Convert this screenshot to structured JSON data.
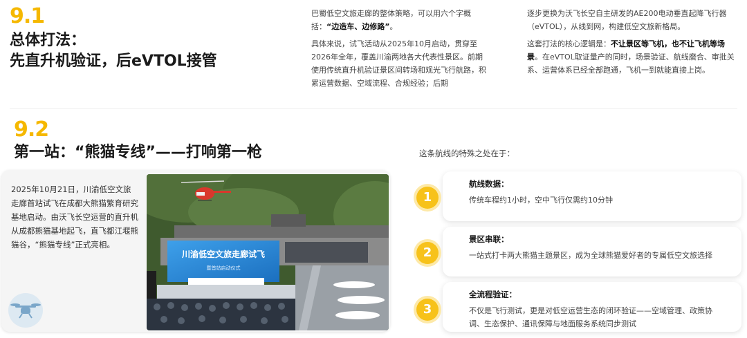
{
  "section1": {
    "number": "9.1",
    "title_line1": "总体打法：",
    "title_line2": "先直升机验证，后eVTOL接管"
  },
  "middle_col": {
    "p1_text": "巴蜀低空文旅走廊的整体策略，可以用六个字概括：",
    "p1_bold": "“边造车、边修路”",
    "p1_end": "。",
    "p2": "具体来说，试飞活动从2025年10月启动，贯穿至2026年全年，覆盖川渝两地各大代表性景区。前期使用传统直升机验证景区间转场和观光飞行航路，积累运营数据、空域流程、合规经验；后期"
  },
  "right_col": {
    "p1": "逐步更换为沃飞长空自主研发的AE200电动垂直起降飞行器（eVTOL），从线到网，构建低空文旅新格局。",
    "p2_start": "这套打法的核心逻辑是：",
    "p2_bold": "不让景区等飞机，也不让飞机等场景",
    "p2_end": "。在eVTOL取证量产的同时，场景验证、航线磨合、审批关系、运营体系已经全部跑通，飞机一到就能直接上岗。"
  },
  "section2": {
    "number": "9.2",
    "title": "第一站：“熊猫专线”——打响第一枪"
  },
  "story": {
    "text": "2025年10月21日，川渝低空文旅走廊首站试飞在成都大熊猫繁育研究基地启动。由沃飞长空运营的直升机从成都熊猫基地起飞，直飞都江堰熊猫谷，“熊猫专线”正式亮相。"
  },
  "photo": {
    "banner_text": "川渝低空文旅走廊试飞",
    "banner_sub": "暨首站启动仪式"
  },
  "features": {
    "intro": "这条航线的特殊之处在于：",
    "items": [
      {
        "num": "1",
        "title": "航线数据：",
        "desc": "传统车程约1小时，空中飞行仅需约10分钟"
      },
      {
        "num": "2",
        "title": "景区串联：",
        "desc": "一站式打卡两大熊猫主题景区，成为全球熊猫爱好者的专属低空文旅选择"
      },
      {
        "num": "3",
        "title": "全流程验证：",
        "desc": "不仅是飞行测试，更是对低空运营生态的闭环验证——空域管理、政策协调、生态保护、通讯保障与地面服务系统同步测试"
      }
    ]
  },
  "colors": {
    "accent": "#f5b800",
    "circle": "#f7c21a"
  }
}
